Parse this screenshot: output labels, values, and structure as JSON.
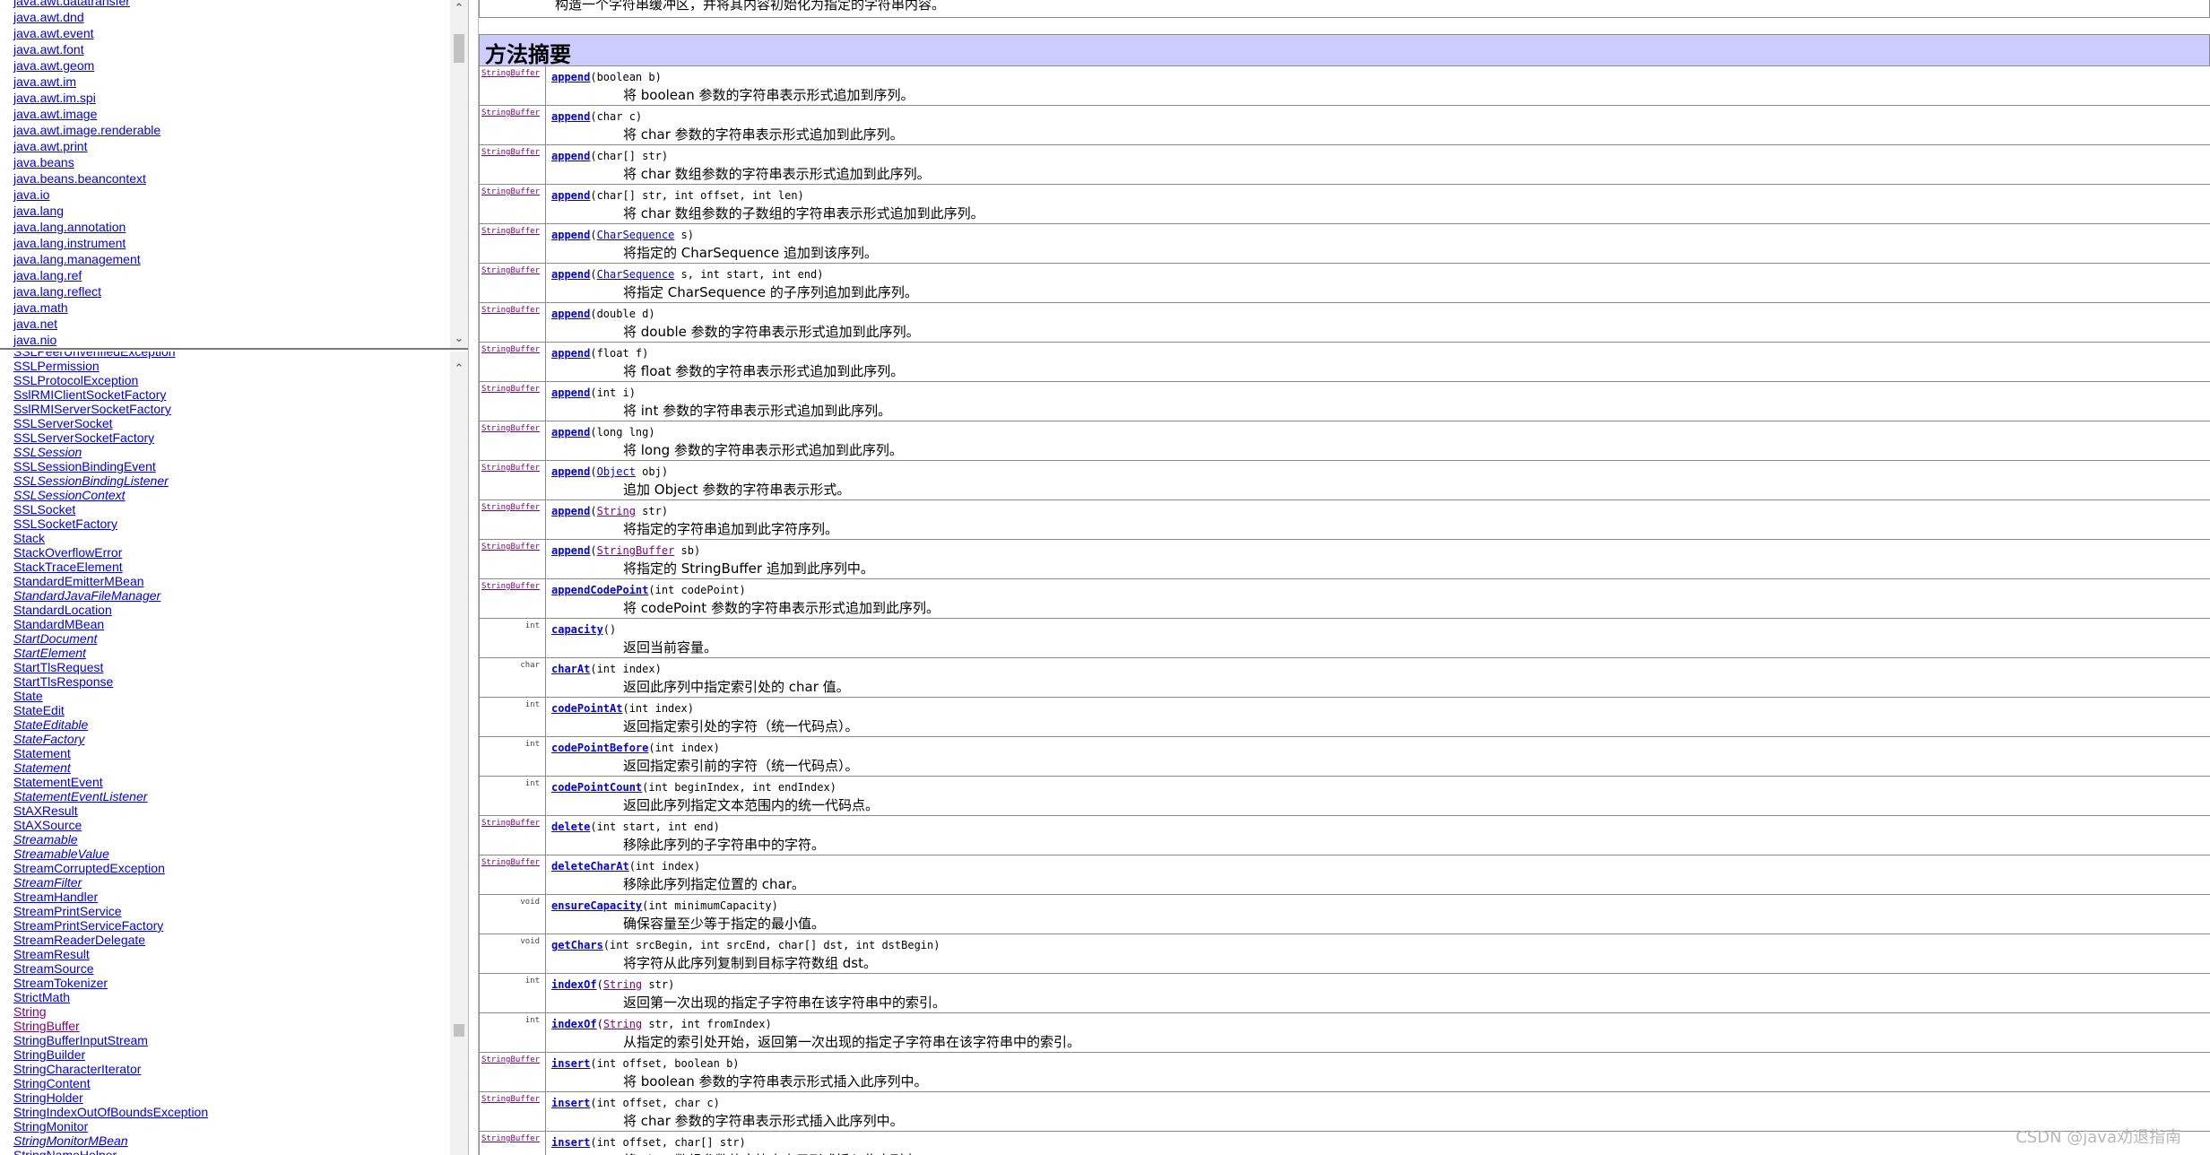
{
  "packages": [
    "java.awt.datatransfer",
    "java.awt.dnd",
    "java.awt.event",
    "java.awt.font",
    "java.awt.geom",
    "java.awt.im",
    "java.awt.im.spi",
    "java.awt.image",
    "java.awt.image.renderable",
    "java.awt.print",
    "java.beans",
    "java.beans.beancontext",
    "java.io",
    "java.lang",
    "java.lang.annotation",
    "java.lang.instrument",
    "java.lang.management",
    "java.lang.ref",
    "java.lang.reflect",
    "java.math",
    "java.net",
    "java.nio"
  ],
  "classes": [
    {
      "name": "SSLPeerUnverifiedException",
      "italic": false,
      "visited": false
    },
    {
      "name": "SSLPermission",
      "italic": false,
      "visited": false
    },
    {
      "name": "SSLProtocolException",
      "italic": false,
      "visited": false
    },
    {
      "name": "SslRMIClientSocketFactory",
      "italic": false,
      "visited": false
    },
    {
      "name": "SslRMIServerSocketFactory",
      "italic": false,
      "visited": false
    },
    {
      "name": "SSLServerSocket",
      "italic": false,
      "visited": false
    },
    {
      "name": "SSLServerSocketFactory",
      "italic": false,
      "visited": false
    },
    {
      "name": "SSLSession",
      "italic": true,
      "visited": false
    },
    {
      "name": "SSLSessionBindingEvent",
      "italic": false,
      "visited": false
    },
    {
      "name": "SSLSessionBindingListener",
      "italic": true,
      "visited": false
    },
    {
      "name": "SSLSessionContext",
      "italic": true,
      "visited": false
    },
    {
      "name": "SSLSocket",
      "italic": false,
      "visited": false
    },
    {
      "name": "SSLSocketFactory",
      "italic": false,
      "visited": false
    },
    {
      "name": "Stack",
      "italic": false,
      "visited": false
    },
    {
      "name": "StackOverflowError",
      "italic": false,
      "visited": false
    },
    {
      "name": "StackTraceElement",
      "italic": false,
      "visited": false
    },
    {
      "name": "StandardEmitterMBean",
      "italic": false,
      "visited": false
    },
    {
      "name": "StandardJavaFileManager",
      "italic": true,
      "visited": false
    },
    {
      "name": "StandardLocation",
      "italic": false,
      "visited": false
    },
    {
      "name": "StandardMBean",
      "italic": false,
      "visited": false
    },
    {
      "name": "StartDocument",
      "italic": true,
      "visited": false
    },
    {
      "name": "StartElement",
      "italic": true,
      "visited": false
    },
    {
      "name": "StartTlsRequest",
      "italic": false,
      "visited": false
    },
    {
      "name": "StartTlsResponse",
      "italic": false,
      "visited": false
    },
    {
      "name": "State",
      "italic": false,
      "visited": false
    },
    {
      "name": "StateEdit",
      "italic": false,
      "visited": false
    },
    {
      "name": "StateEditable",
      "italic": true,
      "visited": false
    },
    {
      "name": "StateFactory",
      "italic": true,
      "visited": false
    },
    {
      "name": "Statement",
      "italic": false,
      "visited": false
    },
    {
      "name": "Statement",
      "italic": true,
      "visited": false
    },
    {
      "name": "StatementEvent",
      "italic": false,
      "visited": false
    },
    {
      "name": "StatementEventListener",
      "italic": true,
      "visited": false
    },
    {
      "name": "StAXResult",
      "italic": false,
      "visited": false
    },
    {
      "name": "StAXSource",
      "italic": false,
      "visited": false
    },
    {
      "name": "Streamable",
      "italic": true,
      "visited": false
    },
    {
      "name": "StreamableValue",
      "italic": true,
      "visited": false
    },
    {
      "name": "StreamCorruptedException",
      "italic": false,
      "visited": false
    },
    {
      "name": "StreamFilter",
      "italic": true,
      "visited": false
    },
    {
      "name": "StreamHandler",
      "italic": false,
      "visited": false
    },
    {
      "name": "StreamPrintService",
      "italic": false,
      "visited": false
    },
    {
      "name": "StreamPrintServiceFactory",
      "italic": false,
      "visited": false
    },
    {
      "name": "StreamReaderDelegate",
      "italic": false,
      "visited": false
    },
    {
      "name": "StreamResult",
      "italic": false,
      "visited": false
    },
    {
      "name": "StreamSource",
      "italic": false,
      "visited": false
    },
    {
      "name": "StreamTokenizer",
      "italic": false,
      "visited": false
    },
    {
      "name": "StrictMath",
      "italic": false,
      "visited": false
    },
    {
      "name": "String",
      "italic": false,
      "visited": true
    },
    {
      "name": "StringBuffer",
      "italic": false,
      "visited": true
    },
    {
      "name": "StringBufferInputStream",
      "italic": false,
      "visited": false
    },
    {
      "name": "StringBuilder",
      "italic": false,
      "visited": false
    },
    {
      "name": "StringCharacterIterator",
      "italic": false,
      "visited": false
    },
    {
      "name": "StringContent",
      "italic": false,
      "visited": false
    },
    {
      "name": "StringHolder",
      "italic": false,
      "visited": false
    },
    {
      "name": "StringIndexOutOfBoundsException",
      "italic": false,
      "visited": false
    },
    {
      "name": "StringMonitor",
      "italic": false,
      "visited": false
    },
    {
      "name": "StringMonitorMBean",
      "italic": true,
      "visited": false
    },
    {
      "name": "StringNameHelper",
      "italic": false,
      "visited": false
    }
  ],
  "content": {
    "prev_description": "构造一个字符串缓冲区，并将其内容初始化为指定的字符串内容。",
    "section_title": "方法摘要",
    "methods": [
      {
        "ret": "StringBuffer",
        "retLink": true,
        "name": "append",
        "params": [
          {
            "t": "(boolean b)"
          }
        ],
        "desc": "将 boolean 参数的字符串表示形式追加到序列。"
      },
      {
        "ret": "StringBuffer",
        "retLink": true,
        "name": "append",
        "params": [
          {
            "t": "(char c)"
          }
        ],
        "desc": "将 char 参数的字符串表示形式追加到此序列。"
      },
      {
        "ret": "StringBuffer",
        "retLink": true,
        "name": "append",
        "params": [
          {
            "t": "(char[] str)"
          }
        ],
        "desc": "将 char 数组参数的字符串表示形式追加到此序列。"
      },
      {
        "ret": "StringBuffer",
        "retLink": true,
        "name": "append",
        "params": [
          {
            "t": "(char[] str, int offset, int len)"
          }
        ],
        "desc": "将 char 数组参数的子数组的字符串表示形式追加到此序列。"
      },
      {
        "ret": "StringBuffer",
        "retLink": true,
        "name": "append",
        "params": [
          {
            "t": "("
          },
          {
            "l": "CharSequence"
          },
          {
            "t": " s)"
          }
        ],
        "desc": "将指定的 CharSequence 追加到该序列。"
      },
      {
        "ret": "StringBuffer",
        "retLink": true,
        "name": "append",
        "params": [
          {
            "t": "("
          },
          {
            "l": "CharSequence"
          },
          {
            "t": " s, int start, int end)"
          }
        ],
        "desc": "将指定 CharSequence 的子序列追加到此序列。"
      },
      {
        "ret": "StringBuffer",
        "retLink": true,
        "name": "append",
        "params": [
          {
            "t": "(double d)"
          }
        ],
        "desc": "将 double 参数的字符串表示形式追加到此序列。"
      },
      {
        "ret": "StringBuffer",
        "retLink": true,
        "name": "append",
        "params": [
          {
            "t": "(float f)"
          }
        ],
        "desc": "将 float 参数的字符串表示形式追加到此序列。"
      },
      {
        "ret": "StringBuffer",
        "retLink": true,
        "name": "append",
        "params": [
          {
            "t": "(int i)"
          }
        ],
        "desc": "将 int 参数的字符串表示形式追加到此序列。"
      },
      {
        "ret": "StringBuffer",
        "retLink": true,
        "name": "append",
        "params": [
          {
            "t": "(long lng)"
          }
        ],
        "desc": "将 long 参数的字符串表示形式追加到此序列。"
      },
      {
        "ret": "StringBuffer",
        "retLink": true,
        "name": "append",
        "params": [
          {
            "t": "("
          },
          {
            "l": "Object"
          },
          {
            "t": " obj)"
          }
        ],
        "desc": "追加 Object 参数的字符串表示形式。"
      },
      {
        "ret": "StringBuffer",
        "retLink": true,
        "name": "append",
        "params": [
          {
            "t": "("
          },
          {
            "l": "String",
            "v": true
          },
          {
            "t": " str)"
          }
        ],
        "desc": "将指定的字符串追加到此字符序列。"
      },
      {
        "ret": "StringBuffer",
        "retLink": true,
        "name": "append",
        "params": [
          {
            "t": "("
          },
          {
            "l": "StringBuffer",
            "v": true
          },
          {
            "t": " sb)"
          }
        ],
        "desc": "将指定的 StringBuffer 追加到此序列中。"
      },
      {
        "ret": "StringBuffer",
        "retLink": true,
        "name": "appendCodePoint",
        "params": [
          {
            "t": "(int codePoint)"
          }
        ],
        "desc": "将 codePoint 参数的字符串表示形式追加到此序列。"
      },
      {
        "ret": "int",
        "retLink": false,
        "name": "capacity",
        "params": [
          {
            "t": "()"
          }
        ],
        "desc": "返回当前容量。"
      },
      {
        "ret": "char",
        "retLink": false,
        "name": "charAt",
        "params": [
          {
            "t": "(int index)"
          }
        ],
        "desc": "返回此序列中指定索引处的 char 值。"
      },
      {
        "ret": "int",
        "retLink": false,
        "name": "codePointAt",
        "params": [
          {
            "t": "(int index)"
          }
        ],
        "desc": "返回指定索引处的字符（统一代码点）。"
      },
      {
        "ret": "int",
        "retLink": false,
        "name": "codePointBefore",
        "params": [
          {
            "t": "(int index)"
          }
        ],
        "desc": "返回指定索引前的字符（统一代码点）。"
      },
      {
        "ret": "int",
        "retLink": false,
        "name": "codePointCount",
        "params": [
          {
            "t": "(int beginIndex, int endIndex)"
          }
        ],
        "desc": "返回此序列指定文本范围内的统一代码点。"
      },
      {
        "ret": "StringBuffer",
        "retLink": true,
        "name": "delete",
        "params": [
          {
            "t": "(int start, int end)"
          }
        ],
        "desc": "移除此序列的子字符串中的字符。"
      },
      {
        "ret": "StringBuffer",
        "retLink": true,
        "name": "deleteCharAt",
        "params": [
          {
            "t": "(int index)"
          }
        ],
        "desc": "移除此序列指定位置的 char。"
      },
      {
        "ret": "void",
        "retLink": false,
        "name": "ensureCapacity",
        "params": [
          {
            "t": "(int minimumCapacity)"
          }
        ],
        "desc": "确保容量至少等于指定的最小值。"
      },
      {
        "ret": "void",
        "retLink": false,
        "name": "getChars",
        "params": [
          {
            "t": "(int srcBegin, int srcEnd, char[] dst, int dstBegin)"
          }
        ],
        "desc": "将字符从此序列复制到目标字符数组 dst。"
      },
      {
        "ret": "int",
        "retLink": false,
        "name": "indexOf",
        "params": [
          {
            "t": "("
          },
          {
            "l": "String",
            "v": true
          },
          {
            "t": " str)"
          }
        ],
        "desc": "返回第一次出现的指定子字符串在该字符串中的索引。"
      },
      {
        "ret": "int",
        "retLink": false,
        "name": "indexOf",
        "params": [
          {
            "t": "("
          },
          {
            "l": "String",
            "v": true
          },
          {
            "t": " str, int fromIndex)"
          }
        ],
        "desc": "从指定的索引处开始，返回第一次出现的指定子字符串在该字符串中的索引。"
      },
      {
        "ret": "StringBuffer",
        "retLink": true,
        "name": "insert",
        "params": [
          {
            "t": "(int offset, boolean b)"
          }
        ],
        "desc": "将 boolean 参数的字符串表示形式插入此序列中。"
      },
      {
        "ret": "StringBuffer",
        "retLink": true,
        "name": "insert",
        "params": [
          {
            "t": "(int offset, char c)"
          }
        ],
        "desc": "将 char 参数的字符串表示形式插入此序列中。"
      },
      {
        "ret": "StringBuffer",
        "retLink": true,
        "name": "insert",
        "params": [
          {
            "t": "(int offset, char[] str)"
          }
        ],
        "desc": "将 char 数组参数的字符串表示形式插入此序列中。"
      }
    ]
  },
  "watermark": "CSDN @java劝退指南",
  "scroll_icons": {
    "up": "chevron-up-icon",
    "down": "chevron-down-icon"
  }
}
